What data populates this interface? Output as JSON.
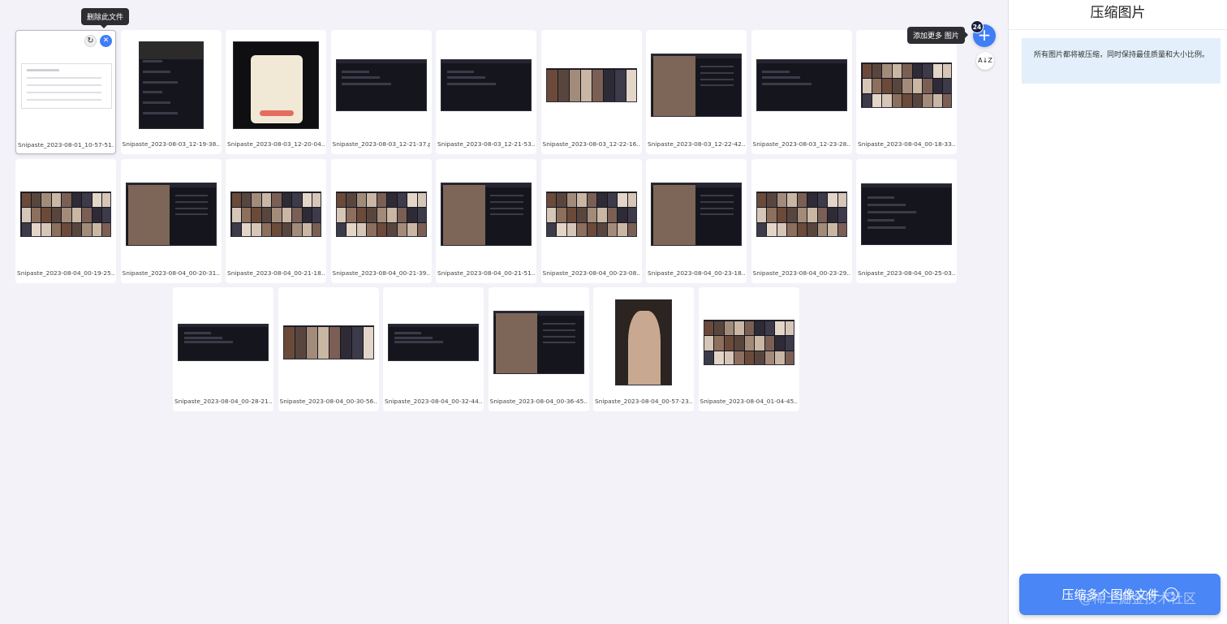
{
  "tooltips": {
    "delete": "删除此文件",
    "add_more": "添加更多 图片"
  },
  "toolbar": {
    "add_icon": "plus-icon",
    "count": "24",
    "sort_icon": "sort-az-icon",
    "sort_label": "A↓Z"
  },
  "panel": {
    "title": "压缩图片",
    "info": "所有图片都将被压缩，同时保持最佳质量和大小比例。",
    "compress_button": "压缩多个图像文件",
    "compress_icon": "arrow-right-circle-icon"
  },
  "watermark": "@稀土掘金技术社区",
  "files": [
    {
      "name": "Snipaste_2023-08-01_10-57-51.p...",
      "kind": "form",
      "selected": true
    },
    {
      "name": "Snipaste_2023-08-03_12-19-38....",
      "kind": "portrait-ui"
    },
    {
      "name": "Snipaste_2023-08-03_12-20-04....",
      "kind": "vip"
    },
    {
      "name": "Snipaste_2023-08-03_12-21-37.p...",
      "kind": "dark-wide"
    },
    {
      "name": "Snipaste_2023-08-03_12-21-53....",
      "kind": "dark-wide"
    },
    {
      "name": "Snipaste_2023-08-03_12-22-16....",
      "kind": "gallery-strip"
    },
    {
      "name": "Snipaste_2023-08-03_12-22-42....",
      "kind": "chat-portrait"
    },
    {
      "name": "Snipaste_2023-08-03_12-23-28....",
      "kind": "dark-wide"
    },
    {
      "name": "Snipaste_2023-08-04_00-18-33....",
      "kind": "gallery"
    },
    {
      "name": "Snipaste_2023-08-04_00-19-25....",
      "kind": "gallery"
    },
    {
      "name": "Snipaste_2023-08-04_00-20-31....",
      "kind": "chat-portrait"
    },
    {
      "name": "Snipaste_2023-08-04_00-21-18....",
      "kind": "gallery"
    },
    {
      "name": "Snipaste_2023-08-04_00-21-39....",
      "kind": "gallery"
    },
    {
      "name": "Snipaste_2023-08-04_00-21-51....",
      "kind": "chat-portrait"
    },
    {
      "name": "Snipaste_2023-08-04_00-23-08....",
      "kind": "gallery"
    },
    {
      "name": "Snipaste_2023-08-04_00-23-18....",
      "kind": "chat-portrait"
    },
    {
      "name": "Snipaste_2023-08-04_00-23-29....",
      "kind": "gallery"
    },
    {
      "name": "Snipaste_2023-08-04_00-25-03....",
      "kind": "dark-menu"
    },
    {
      "name": "Snipaste_2023-08-04_00-28-21....",
      "kind": "dark-wide-short"
    },
    {
      "name": "Snipaste_2023-08-04_00-30-56....",
      "kind": "gallery-strip"
    },
    {
      "name": "Snipaste_2023-08-04_00-32-44....",
      "kind": "dark-wide-short"
    },
    {
      "name": "Snipaste_2023-08-04_00-36-45....",
      "kind": "chat-portrait"
    },
    {
      "name": "Snipaste_2023-08-04_00-57-23....",
      "kind": "photo"
    },
    {
      "name": "Snipaste_2023-08-04_01-04-45....",
      "kind": "gallery"
    }
  ]
}
